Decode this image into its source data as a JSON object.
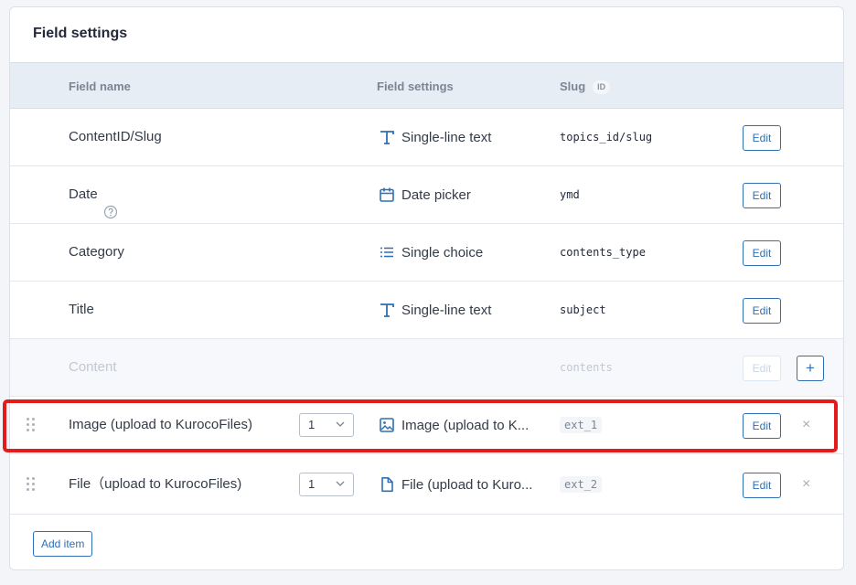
{
  "card": {
    "title": "Field settings"
  },
  "headers": {
    "name": "Field name",
    "settings": "Field settings",
    "slug": "Slug",
    "slug_badge": "ID"
  },
  "rows": [
    {
      "name": "ContentID/Slug",
      "setting": "Single-line text",
      "setting_icon": "text-icon",
      "slug": "topics_id/slug",
      "edit": "Edit"
    },
    {
      "name": "Date",
      "setting": "Date picker",
      "setting_icon": "calendar-icon",
      "slug": "ymd",
      "edit": "Edit"
    },
    {
      "name": "Category",
      "setting": "Single choice",
      "setting_icon": "list-icon",
      "slug": "contents_type",
      "edit": "Edit"
    },
    {
      "name": "Title",
      "setting": "Single-line text",
      "setting_icon": "text-icon",
      "slug": "subject",
      "edit": "Edit"
    },
    {
      "name": "Content",
      "slug": "contents",
      "edit": "Edit",
      "add": "+"
    },
    {
      "name": "Image (upload to KurocoFiles)",
      "count": "1",
      "setting": "Image (upload to K...",
      "setting_icon": "image-icon",
      "slug": "ext_1",
      "edit": "Edit",
      "remove": "×"
    },
    {
      "name": "File（upload to KurocoFiles)",
      "count": "1",
      "setting": "File (upload to Kuro...",
      "setting_icon": "file-icon",
      "slug": "ext_2",
      "edit": "Edit",
      "remove": "×"
    }
  ],
  "add_item": "Add item",
  "colors": {
    "accent": "#2f6fb4",
    "highlight": "#e31b1b",
    "header_bg": "#e7edf4"
  }
}
